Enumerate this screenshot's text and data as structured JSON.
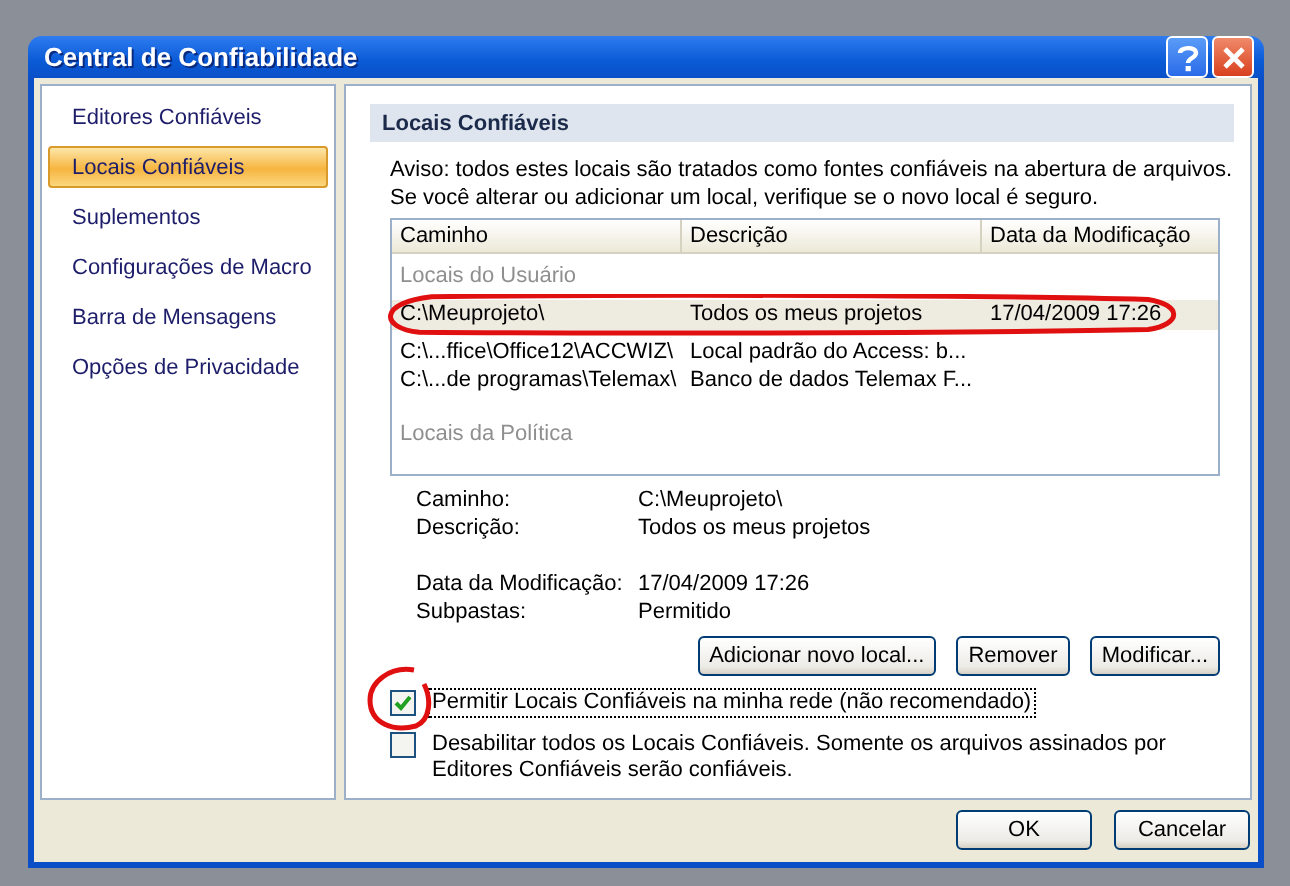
{
  "window": {
    "title": "Central de Confiabilidade"
  },
  "sidebar": {
    "items": [
      {
        "label": "Editores Confiáveis",
        "selected": false
      },
      {
        "label": "Locais Confiáveis",
        "selected": true
      },
      {
        "label": "Suplementos",
        "selected": false
      },
      {
        "label": "Configurações de Macro",
        "selected": false
      },
      {
        "label": "Barra de Mensagens",
        "selected": false
      },
      {
        "label": "Opções de Privacidade",
        "selected": false
      }
    ]
  },
  "section": {
    "title": "Locais Confiáveis",
    "notice": [
      "Aviso: todos estes locais são tratados como fontes confiáveis na abertura de arquivos.",
      "Se você alterar ou adicionar um local, verifique se o novo local é seguro."
    ]
  },
  "table": {
    "columns": [
      "Caminho",
      "Descrição",
      "Data da Modificação"
    ],
    "groups": [
      {
        "label": "Locais do Usuário",
        "rows": [
          {
            "cells": [
              "C:\\Meuprojeto\\",
              "Todos os meus projetos",
              "17/04/2009 17:26"
            ],
            "selected": true
          },
          {
            "cells": [
              "C:\\...ffice\\Office12\\ACCWIZ\\",
              "Local padrão do Access: b..."
            ],
            "selected": false
          },
          {
            "cells": [
              "C:\\...de programas\\Telemax\\",
              "Banco de dados Telemax F..."
            ],
            "selected": false
          }
        ]
      },
      {
        "label": "Locais da Política"
      }
    ]
  },
  "details": [
    [
      {
        "label": "Caminho:",
        "value": "C:\\Meuprojeto\\"
      },
      {
        "label": "Descrição:",
        "value": "Todos os meus projetos"
      }
    ],
    [
      {
        "label": "Data da Modificação:",
        "value": "17/04/2009 17:26"
      },
      {
        "label": "Subpastas:",
        "value": "Permitido"
      }
    ]
  ],
  "actions": [
    "Adicionar novo local...",
    "Remover",
    "Modificar..."
  ],
  "options": [
    {
      "label": "Permitir Locais Confiáveis na minha rede (não recomendado)",
      "checked": true,
      "focused": true
    },
    {
      "label": "Desabilitar todos os Locais Confiáveis. Somente os arquivos assinados por Editores Confiáveis serão confiáveis.",
      "checked": false,
      "focused": false
    }
  ],
  "footer": [
    "OK",
    "Cancelar"
  ]
}
